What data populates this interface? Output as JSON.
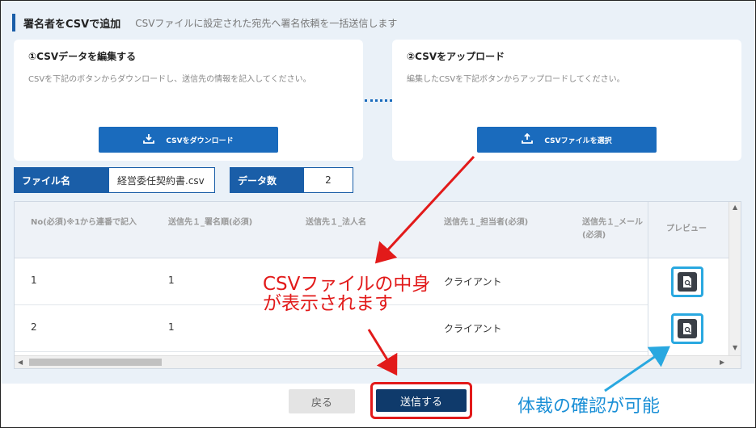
{
  "header": {
    "title": "署名者をCSVで追加",
    "subtitle": "CSVファイルに設定された宛先へ署名依頼を一括送信します"
  },
  "step1": {
    "title": "①CSVデータを編集する",
    "desc": "CSVを下記のボタンからダウンロードし、送信先の情報を記入してください。",
    "button": "CSVをダウンロード",
    "icon": "download-icon"
  },
  "step2": {
    "title": "②CSVをアップロード",
    "desc": "編集したCSVを下記ボタンからアップロードしてください。",
    "button": "CSVファイルを選択",
    "icon": "upload-icon"
  },
  "file_info": {
    "file_label": "ファイル名",
    "file_value": "経営委任契約書.csv",
    "count_label": "データ数",
    "count_value": "2"
  },
  "table": {
    "headers": [
      "No(必須)※1から連番で記入",
      "送信先１_署名順(必須)",
      "送信先１_法人名",
      "送信先１_担当者(必須)",
      "送信先１_メール(必須)",
      "プレビュー"
    ],
    "rows": [
      {
        "no": "1",
        "order": "1",
        "company": "",
        "person": "クライアント"
      },
      {
        "no": "2",
        "order": "1",
        "company": "",
        "person": "クライアント"
      }
    ]
  },
  "footer": {
    "back": "戻る",
    "submit": "送信する"
  },
  "annotations": {
    "red_line1": "CSVファイルの中身",
    "red_line2": "が表示されます",
    "blue": "体裁の確認が可能"
  },
  "colors": {
    "primary": "#1a6bbd",
    "navy": "#0f3a6b",
    "annotation_red": "#e21a1a",
    "annotation_blue": "#29a8e0"
  }
}
